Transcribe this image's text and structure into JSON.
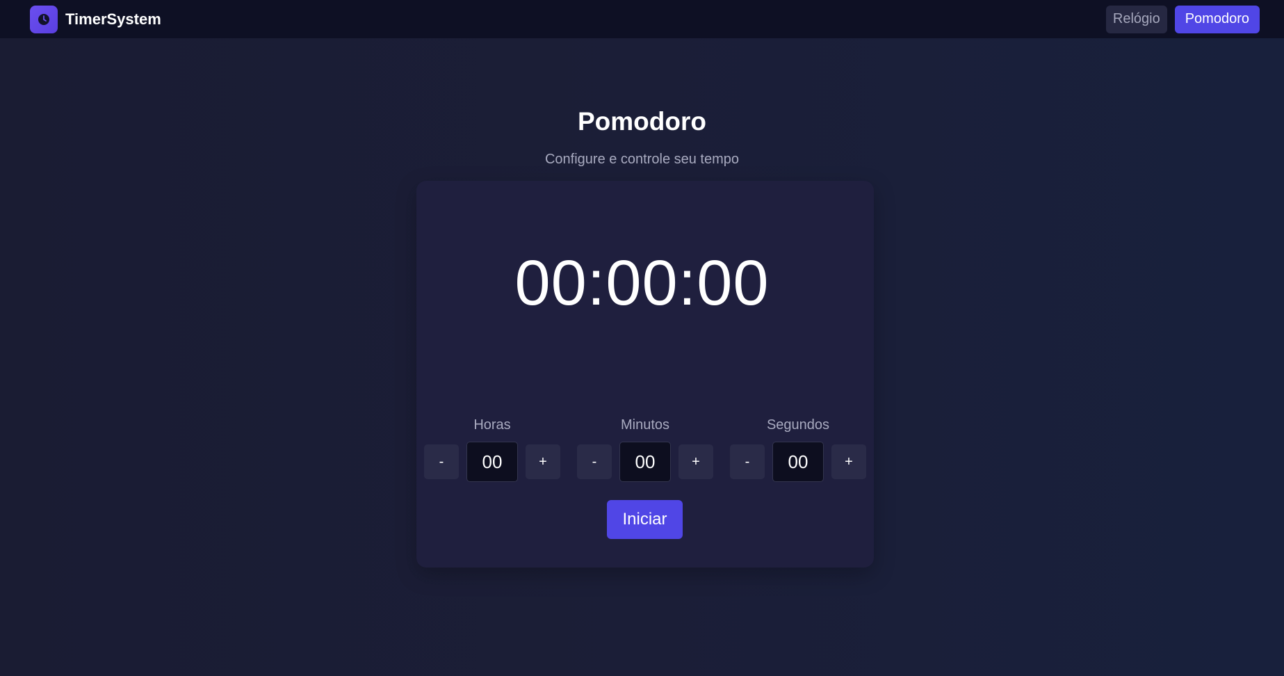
{
  "navbar": {
    "brand": "TimerSystem",
    "logo_icon": "clock-icon",
    "links": [
      {
        "label": "Relógio",
        "active": false
      },
      {
        "label": "Pomodoro",
        "active": true
      }
    ]
  },
  "page": {
    "title": "Pomodoro",
    "subtitle": "Configure e controle seu tempo"
  },
  "timer": {
    "display": "00:00:00",
    "units": [
      {
        "label": "Horas",
        "value": "00",
        "minus": "-",
        "plus": "+"
      },
      {
        "label": "Minutos",
        "value": "00",
        "minus": "-",
        "plus": "+"
      },
      {
        "label": "Segundos",
        "value": "00",
        "minus": "-",
        "plus": "+"
      }
    ],
    "start_label": "Iniciar"
  },
  "colors": {
    "accent": "#5046e6",
    "background": "#1a1c33",
    "card": "#1f1f3e",
    "navbar": "#0e1024"
  }
}
